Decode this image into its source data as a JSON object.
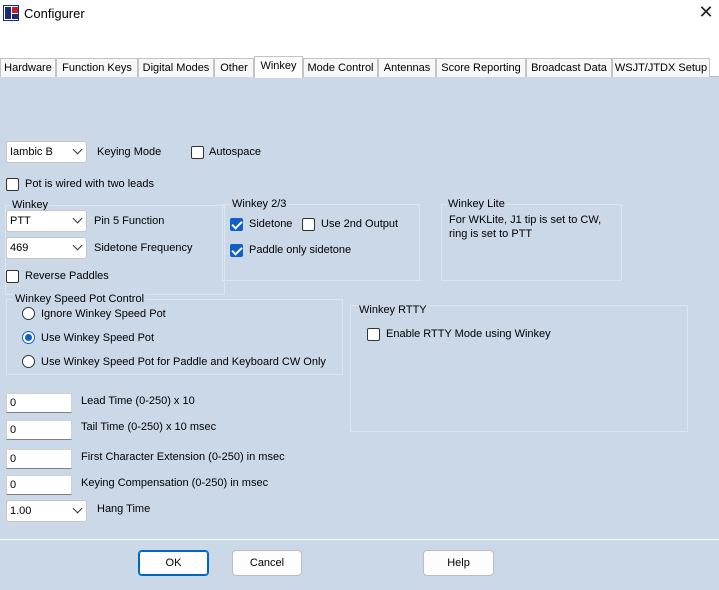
{
  "window": {
    "title": "Configurer",
    "close_glyph": "✕"
  },
  "tabs": [
    {
      "label": "Hardware"
    },
    {
      "label": "Function Keys"
    },
    {
      "label": "Digital Modes"
    },
    {
      "label": "Other"
    },
    {
      "label": "Winkey"
    },
    {
      "label": "Mode Control"
    },
    {
      "label": "Antennas"
    },
    {
      "label": "Score Reporting"
    },
    {
      "label": "Broadcast Data"
    },
    {
      "label": "WSJT/JTDX Setup"
    }
  ],
  "active_tab": "Winkey",
  "keying": {
    "mode_value": "Iambic B",
    "mode_label": "Keying Mode",
    "autospace_label": "Autospace",
    "autospace_checked": false
  },
  "pot_two_leads": {
    "label": "Pot is wired with two leads",
    "checked": false
  },
  "winkey": {
    "group_label": "Winkey",
    "pin5_value": "PTT",
    "pin5_label": "Pin 5 Function",
    "sidetone_value": "469",
    "sidetone_label": "Sidetone Frequency",
    "reverse_paddles_label": "Reverse Paddles",
    "reverse_paddles_checked": false
  },
  "winkey23": {
    "group_label": "Winkey 2/3",
    "sidetone_label": "Sidetone",
    "sidetone_checked": true,
    "second_output_label": "Use 2nd Output",
    "second_output_checked": false,
    "paddle_only_label": "Paddle only sidetone",
    "paddle_only_checked": true
  },
  "winkey_lite": {
    "group_label": "Winkey Lite",
    "note_line1": "For WKLite, J1 tip is set to CW,",
    "note_line2": "ring is set to PTT"
  },
  "speed_pot": {
    "group_label": "Winkey Speed Pot Control",
    "options": [
      {
        "label": "Ignore Winkey Speed Pot",
        "selected": false
      },
      {
        "label": "Use Winkey Speed Pot",
        "selected": true
      },
      {
        "label": "Use Winkey Speed Pot for Paddle and Keyboard CW Only",
        "selected": false
      }
    ]
  },
  "rtty": {
    "group_label": "Winkey RTTY",
    "enable_label": "Enable RTTY Mode using Winkey",
    "enable_checked": false
  },
  "timing": {
    "lead_value": "0",
    "lead_label": "Lead Time (0-250) x 10",
    "tail_value": "0",
    "tail_label": "Tail Time (0-250) x 10 msec",
    "first_char_value": "0",
    "first_char_label": "First Character Extension (0-250) in msec",
    "keying_comp_value": "0",
    "keying_comp_label": "Keying Compensation (0-250) in msec",
    "hang_value": "1.00",
    "hang_label": "Hang Time"
  },
  "buttons": {
    "ok": "OK",
    "cancel": "Cancel",
    "help": "Help"
  },
  "colors": {
    "panel_bg": "#cbd8e8",
    "accent": "#1060c8",
    "ok_border": "#0067c0"
  }
}
